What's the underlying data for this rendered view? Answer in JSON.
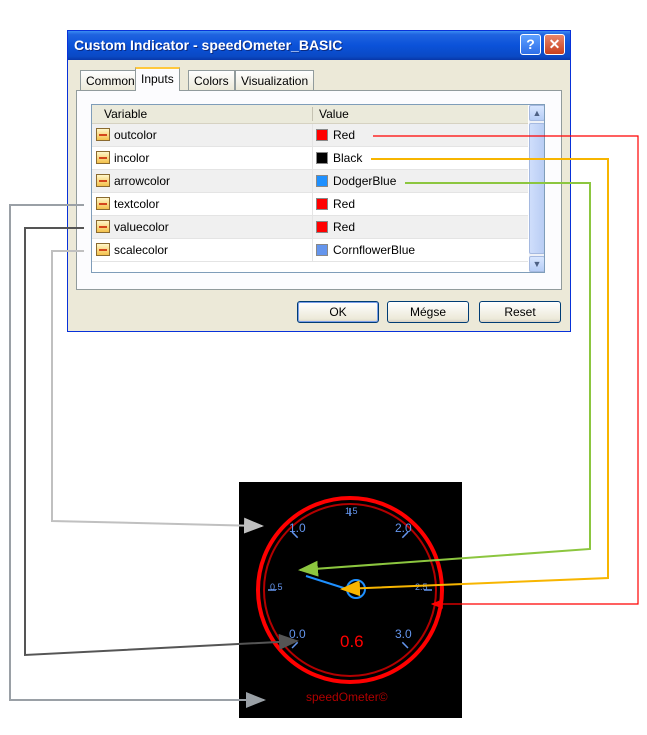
{
  "window": {
    "title": "Custom Indicator - speedOmeter_BASIC",
    "help_label": "?",
    "close_label": "✕",
    "help_icon": "question-icon",
    "close_icon": "close-icon"
  },
  "tabs": [
    {
      "label": "Common"
    },
    {
      "label": "Inputs",
      "active": true
    },
    {
      "label": "Colors"
    },
    {
      "label": "Visualization"
    }
  ],
  "grid": {
    "columns": [
      "Variable",
      "Value"
    ],
    "rows": [
      {
        "name": "outcolor",
        "value": "Red",
        "color": "#ff0000"
      },
      {
        "name": "incolor",
        "value": "Black",
        "color": "#000000"
      },
      {
        "name": "arrowcolor",
        "value": "DodgerBlue",
        "color": "#1e90ff"
      },
      {
        "name": "textcolor",
        "value": "Red",
        "color": "#ff0000"
      },
      {
        "name": "valuecolor",
        "value": "Red",
        "color": "#ff0000"
      },
      {
        "name": "scalecolor",
        "value": "CornflowerBlue",
        "color": "#6495ed"
      }
    ]
  },
  "buttons": {
    "ok": "OK",
    "cancel": "Mégse",
    "reset": "Reset"
  },
  "gauge": {
    "scale_labels": [
      "0.0",
      "0.5",
      "1.0",
      "1.5",
      "2.0",
      "2.5",
      "3.0"
    ],
    "value": "0.6",
    "brand": "speedOmeter©",
    "ring_color": "#ff0000",
    "needle_color": "#1e90ff",
    "scale_color": "#6495ed"
  },
  "connector_colors": {
    "outcolor": "#ff0000",
    "incolor": "#f7b500",
    "arrowcolor": "#8cc63f",
    "textcolor": "#9aa0a6",
    "valuecolor": "#555555",
    "scalecolor": "#c0c0c0"
  }
}
